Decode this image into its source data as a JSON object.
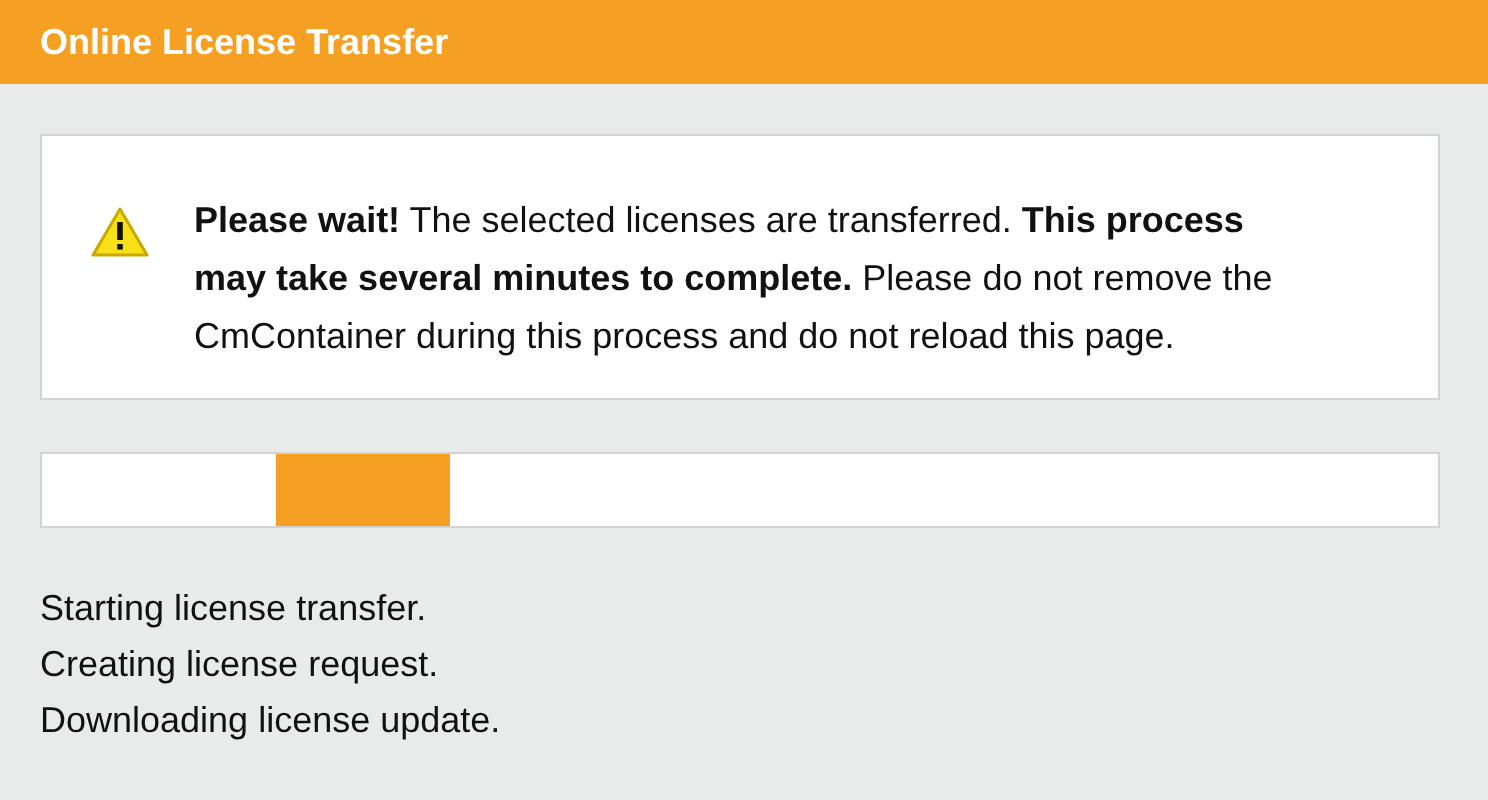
{
  "header": {
    "title": "Online License Transfer"
  },
  "message": {
    "kind": "warning",
    "text": "**Please wait!** The selected licenses are transferred. **This process may take several minutes to complete.** Please do not remove the CmContainer during this process and do not reload this page."
  },
  "progress": {
    "kind": "indeterminate"
  },
  "log": [
    "Starting license transfer.",
    "Creating license request.",
    "Downloading license update."
  ]
}
